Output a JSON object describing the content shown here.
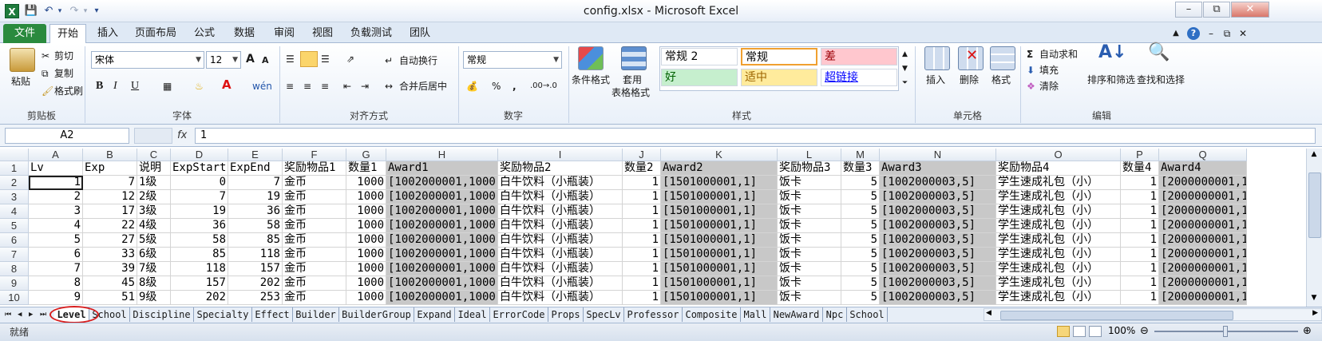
{
  "window": {
    "title": "config.xlsx - Microsoft Excel",
    "app_icon": "X"
  },
  "ribbon_tabs": [
    "文件",
    "开始",
    "插入",
    "页面布局",
    "公式",
    "数据",
    "审阅",
    "视图",
    "负载测试",
    "团队"
  ],
  "clipboard": {
    "paste": "粘贴",
    "cut": "剪切",
    "copy": "复制",
    "format_painter": "格式刷",
    "group": "剪贴板"
  },
  "font": {
    "name": "宋体",
    "size": "12",
    "bold": "B",
    "italic": "I",
    "underline": "U",
    "grow": "A",
    "shrink": "A",
    "wen": "wén",
    "group": "字体"
  },
  "alignment": {
    "wrap": "自动换行",
    "merge": "合并后居中",
    "group": "对齐方式"
  },
  "number": {
    "format": "常规",
    "percent": "%",
    "comma": ",",
    "inc_dec": ".00→.0",
    "group": "数字"
  },
  "styles": {
    "conditional": "条件格式",
    "table_fmt": [
      "套用",
      "表格格式"
    ],
    "cells": [
      {
        "label": "常规 2",
        "bg": "#ffffff",
        "color": "#000000"
      },
      {
        "label": "常规",
        "bg": "#ffffff",
        "color": "#000000"
      },
      {
        "label": "差",
        "bg": "#ffc7ce",
        "color": "#9c0006"
      },
      {
        "label": "好",
        "bg": "#c6efce",
        "color": "#006100"
      },
      {
        "label": "适中",
        "bg": "#ffeb9c",
        "color": "#9c6500"
      },
      {
        "label": "超链接",
        "bg": "#ffffff",
        "color": "#0000ff"
      }
    ],
    "group": "样式"
  },
  "cells_group": {
    "insert": "插入",
    "delete": "删除",
    "format": "格式",
    "group": "单元格"
  },
  "editing": {
    "autosum": "自动求和",
    "fill": "填充",
    "clear": "清除",
    "sort": "排序和筛选",
    "find": "查找和选择",
    "group": "编辑"
  },
  "formula_bar": {
    "name_box": "A2",
    "fx": "fx",
    "value": "1"
  },
  "grid": {
    "columns": [
      "A",
      "B",
      "C",
      "D",
      "E",
      "F",
      "G",
      "H",
      "I",
      "J",
      "K",
      "L",
      "M",
      "N",
      "O",
      "P",
      "Q"
    ],
    "row_numbers": [
      "1",
      "2",
      "3",
      "4",
      "5",
      "6",
      "7",
      "8",
      "9",
      "10"
    ],
    "rows": [
      [
        "Lv",
        "Exp",
        "说明",
        "ExpStart",
        "ExpEnd",
        "奖励物品1",
        "数量1",
        "Award1",
        "奖励物品2",
        "数量2",
        "Award2",
        "奖励物品3",
        "数量3",
        "Award3",
        "奖励物品4",
        "数量4",
        "Award4"
      ],
      [
        "1",
        "7",
        "1级",
        "0",
        "7",
        "金币",
        "1000",
        "[1002000001,1000]",
        "白牛饮料（小瓶装）",
        "1",
        "[1501000001,1]",
        "饭卡",
        "5",
        "[1002000003,5]",
        "学生速成礼包（小）",
        "1",
        "[2000000001,1"
      ],
      [
        "2",
        "12",
        "2级",
        "7",
        "19",
        "金币",
        "1000",
        "[1002000001,1000]",
        "白牛饮料（小瓶装）",
        "1",
        "[1501000001,1]",
        "饭卡",
        "5",
        "[1002000003,5]",
        "学生速成礼包（小）",
        "1",
        "[2000000001,1"
      ],
      [
        "3",
        "17",
        "3级",
        "19",
        "36",
        "金币",
        "1000",
        "[1002000001,1000]",
        "白牛饮料（小瓶装）",
        "1",
        "[1501000001,1]",
        "饭卡",
        "5",
        "[1002000003,5]",
        "学生速成礼包（小）",
        "1",
        "[2000000001,1"
      ],
      [
        "4",
        "22",
        "4级",
        "36",
        "58",
        "金币",
        "1000",
        "[1002000001,1000]",
        "白牛饮料（小瓶装）",
        "1",
        "[1501000001,1]",
        "饭卡",
        "5",
        "[1002000003,5]",
        "学生速成礼包（小）",
        "1",
        "[2000000001,1"
      ],
      [
        "5",
        "27",
        "5级",
        "58",
        "85",
        "金币",
        "1000",
        "[1002000001,1000]",
        "白牛饮料（小瓶装）",
        "1",
        "[1501000001,1]",
        "饭卡",
        "5",
        "[1002000003,5]",
        "学生速成礼包（小）",
        "1",
        "[2000000001,1"
      ],
      [
        "6",
        "33",
        "6级",
        "85",
        "118",
        "金币",
        "1000",
        "[1002000001,1000]",
        "白牛饮料（小瓶装）",
        "1",
        "[1501000001,1]",
        "饭卡",
        "5",
        "[1002000003,5]",
        "学生速成礼包（小）",
        "1",
        "[2000000001,1"
      ],
      [
        "7",
        "39",
        "7级",
        "118",
        "157",
        "金币",
        "1000",
        "[1002000001,1000]",
        "白牛饮料（小瓶装）",
        "1",
        "[1501000001,1]",
        "饭卡",
        "5",
        "[1002000003,5]",
        "学生速成礼包（小）",
        "1",
        "[2000000001,1"
      ],
      [
        "8",
        "45",
        "8级",
        "157",
        "202",
        "金币",
        "1000",
        "[1002000001,1000]",
        "白牛饮料（小瓶装）",
        "1",
        "[1501000001,1]",
        "饭卡",
        "5",
        "[1002000003,5]",
        "学生速成礼包（小）",
        "1",
        "[2000000001,1"
      ],
      [
        "9",
        "51",
        "9级",
        "202",
        "253",
        "金币",
        "1000",
        "[1002000001,1000]",
        "白牛饮料（小瓶装）",
        "1",
        "[1501000001,1]",
        "饭卡",
        "5",
        "[1002000003,5]",
        "学生速成礼包（小）",
        "1",
        "[2000000001,1"
      ]
    ],
    "shaded_columns": [
      "H",
      "K",
      "N",
      "Q"
    ],
    "selected_cell": "A2"
  },
  "sheet_tabs": [
    "Level",
    "School",
    "Discipline",
    "Specialty",
    "Effect",
    "Builder",
    "BuilderGroup",
    "Expand",
    "Ideal",
    "ErrorCode",
    "Props",
    "SpecLv",
    "Professor",
    "Composite",
    "Mall",
    "NewAward",
    "Npc",
    "School"
  ],
  "active_sheet": "Level",
  "status": {
    "ready": "就绪",
    "zoom": "100%"
  },
  "colors": {
    "file_tab": "#2a8a3e",
    "active_sheet_circle": "#d81e1e",
    "shaded_col": "#c8c8c8"
  }
}
